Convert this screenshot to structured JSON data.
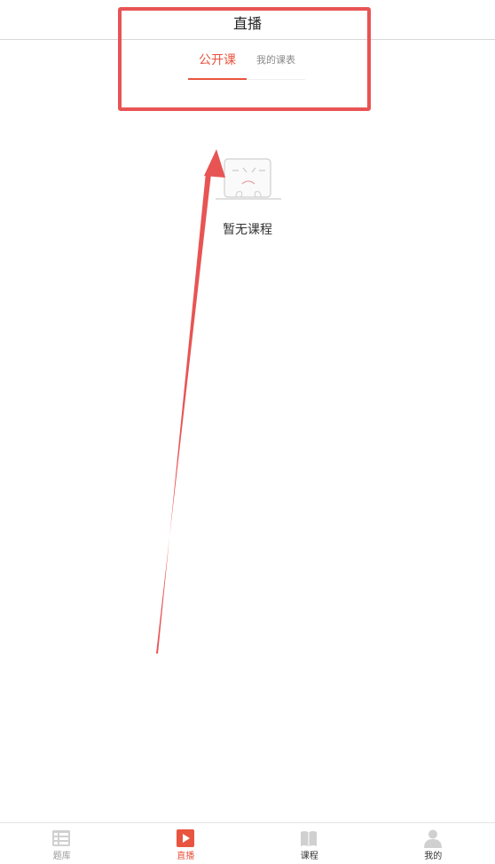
{
  "header": {
    "title": "直播"
  },
  "tabs": [
    {
      "label": "公开课",
      "active": true
    },
    {
      "label": "我的课表",
      "active": false
    }
  ],
  "empty_state": {
    "text": "暂无课程",
    "icon": "empty-box-face-icon"
  },
  "bottom_nav": [
    {
      "label": "题库",
      "icon": "question-bank-icon",
      "active": false
    },
    {
      "label": "直播",
      "icon": "live-play-icon",
      "active": true
    },
    {
      "label": "课程",
      "icon": "open-book-icon",
      "active": false
    },
    {
      "label": "我的",
      "icon": "user-profile-icon",
      "active": false
    }
  ],
  "colors": {
    "accent": "#e8543f",
    "annotation": "#e85454",
    "inactive": "#9a9a9a"
  }
}
